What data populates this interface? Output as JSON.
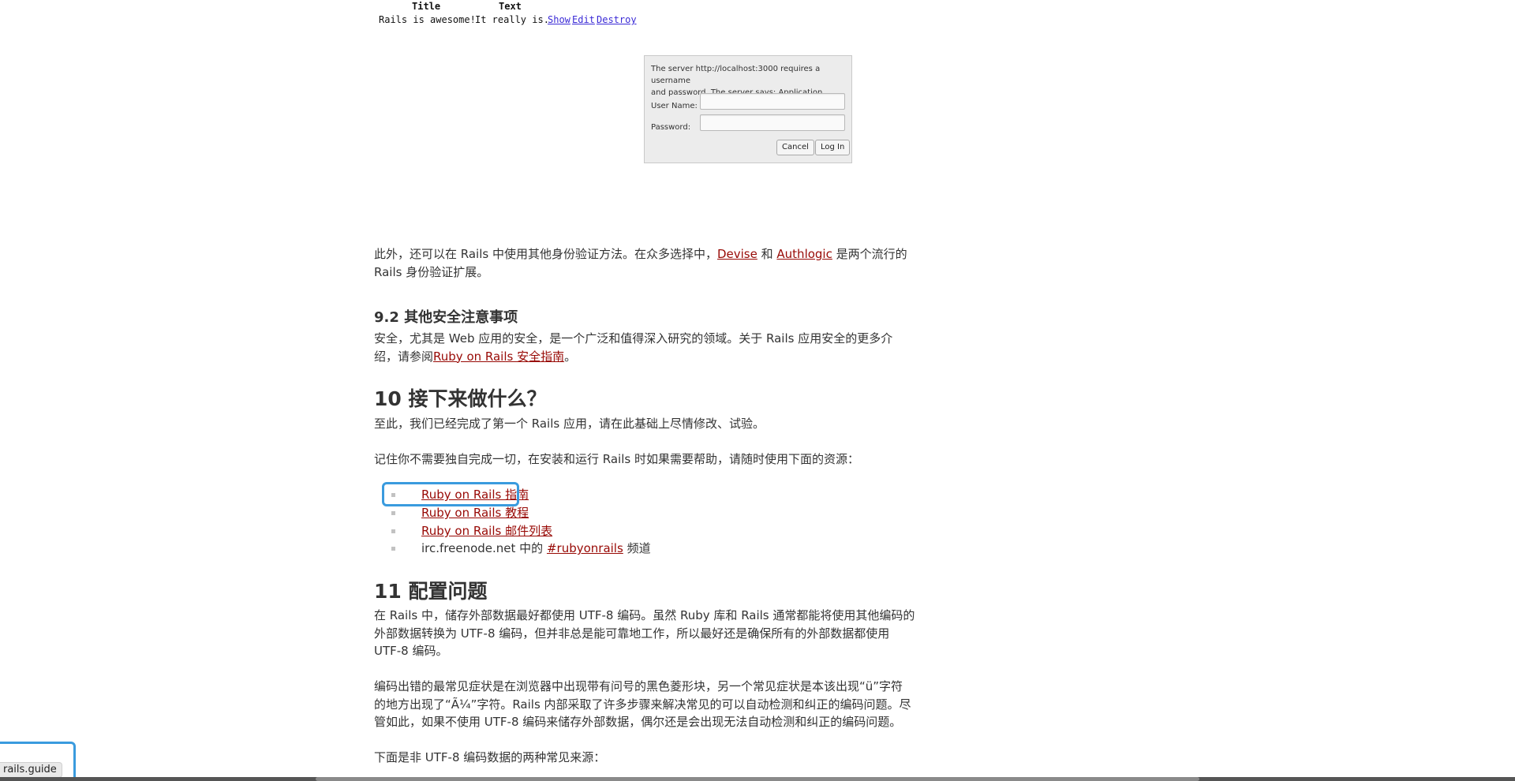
{
  "figure": {
    "table": {
      "headers": [
        "Title",
        "Text"
      ],
      "row": {
        "title": "Rails is awesome!",
        "text": "It really is.",
        "links": [
          "Show",
          "Edit",
          "Destroy"
        ]
      }
    },
    "auth_dialog": {
      "message_line1": "The server http://localhost:3000 requires a username",
      "message_line2": "and password. The server says: Application.",
      "username_label": "User Name:",
      "password_label": "Password:",
      "username_value": "",
      "password_value": "",
      "cancel_label": "Cancel",
      "login_label": "Log In"
    }
  },
  "article": {
    "p_other_auth": {
      "line1_before": "此外，还可以在 Rails 中使用其他身份验证方法。在众多选择中，",
      "link_devise": "Devise",
      "line1_mid": " 和 ",
      "link_authlogic": "Authlogic",
      "line1_after": " 是两个流行的",
      "line2": "Rails 身份验证扩展。"
    },
    "h_9_2": "9.2 其他安全注意事项",
    "p_security": {
      "line1": "安全，尤其是 Web 应用的安全，是一个广泛和值得深入研究的领域。关于 Rails 应用安全的更多介",
      "line2_before": "绍，请参阅",
      "link": "Ruby on Rails 安全指南",
      "line2_after": "。"
    },
    "h_10": "10 接下来做什么？",
    "p_done": "至此，我们已经完成了第一个 Rails 应用，请在此基础上尽情修改、试验。",
    "p_resources": "记住你不需要独自完成一切，在安装和运行 Rails 时如果需要帮助，请随时使用下面的资源：",
    "resources": {
      "guides": "Ruby on Rails 指南",
      "tutorial": "Ruby on Rails 教程",
      "mailing_list": "Ruby on Rails 邮件列表",
      "irc_before": "irc.freenode.net 中的 ",
      "irc_link": "#rubyonrails",
      "irc_after": " 频道"
    },
    "h_11": "11 配置问题",
    "p_utf8": {
      "line1": "在 Rails 中，储存外部数据最好都使用 UTF-8 编码。虽然 Ruby 库和 Rails 通常都能将使用其他编码的",
      "line2": "外部数据转换为 UTF-8 编码，但并非总是能可靠地工作，所以最好还是确保所有的外部数据都使用",
      "line3": "UTF-8 编码。"
    },
    "p_symptoms": {
      "line1": "编码出错的最常见症状是在浏览器中出现带有问号的黑色菱形块，另一个常见症状是本该出现“ü”字符",
      "line2": "的地方出现了“Ã¼”字符。Rails 内部采取了许多步骤来解决常见的可以自动检测和纠正的编码问题。尽",
      "line3": "管如此，如果不使用 UTF-8 编码来储存外部数据，偶尔还是会出现无法自动检测和纠正的编码问题。"
    },
    "p_sources": "下面是非 UTF-8 编码数据的两种常见来源："
  },
  "status_bar": {
    "url": "rails.guide"
  }
}
